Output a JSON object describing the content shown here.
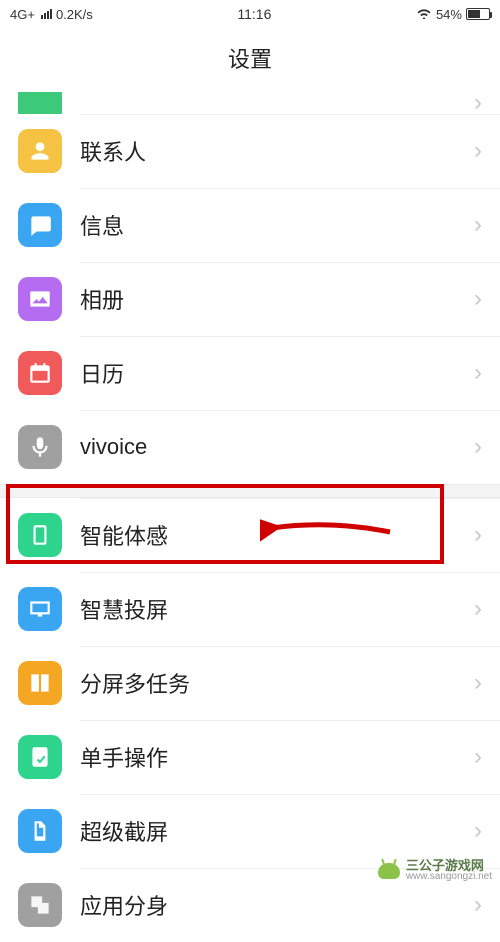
{
  "status": {
    "network": "4G+",
    "speed": "0.2K/s",
    "time": "11:16",
    "battery_pct": "54%"
  },
  "header": {
    "title": "设置"
  },
  "group1": [
    {
      "label": "",
      "color": "#3cc97a"
    },
    {
      "label": "联系人",
      "color": "#f6c244"
    },
    {
      "label": "信息",
      "color": "#3aa5f0"
    },
    {
      "label": "相册",
      "color": "#b56cf0"
    },
    {
      "label": "日历",
      "color": "#f05a5a"
    },
    {
      "label": "vivoice",
      "color": "#a0a0a0"
    }
  ],
  "group2": [
    {
      "label": "智能体感",
      "color": "#2fd48c"
    },
    {
      "label": "智慧投屏",
      "color": "#3aa5f0"
    },
    {
      "label": "分屏多任务",
      "color": "#f5a623"
    },
    {
      "label": "单手操作",
      "color": "#2fd48c"
    },
    {
      "label": "超级截屏",
      "color": "#3aa5f0"
    },
    {
      "label": "应用分身",
      "color": "#a0a0a0"
    }
  ],
  "watermark": {
    "name": "三公子游戏网",
    "url": "www.sangongzi.net"
  }
}
